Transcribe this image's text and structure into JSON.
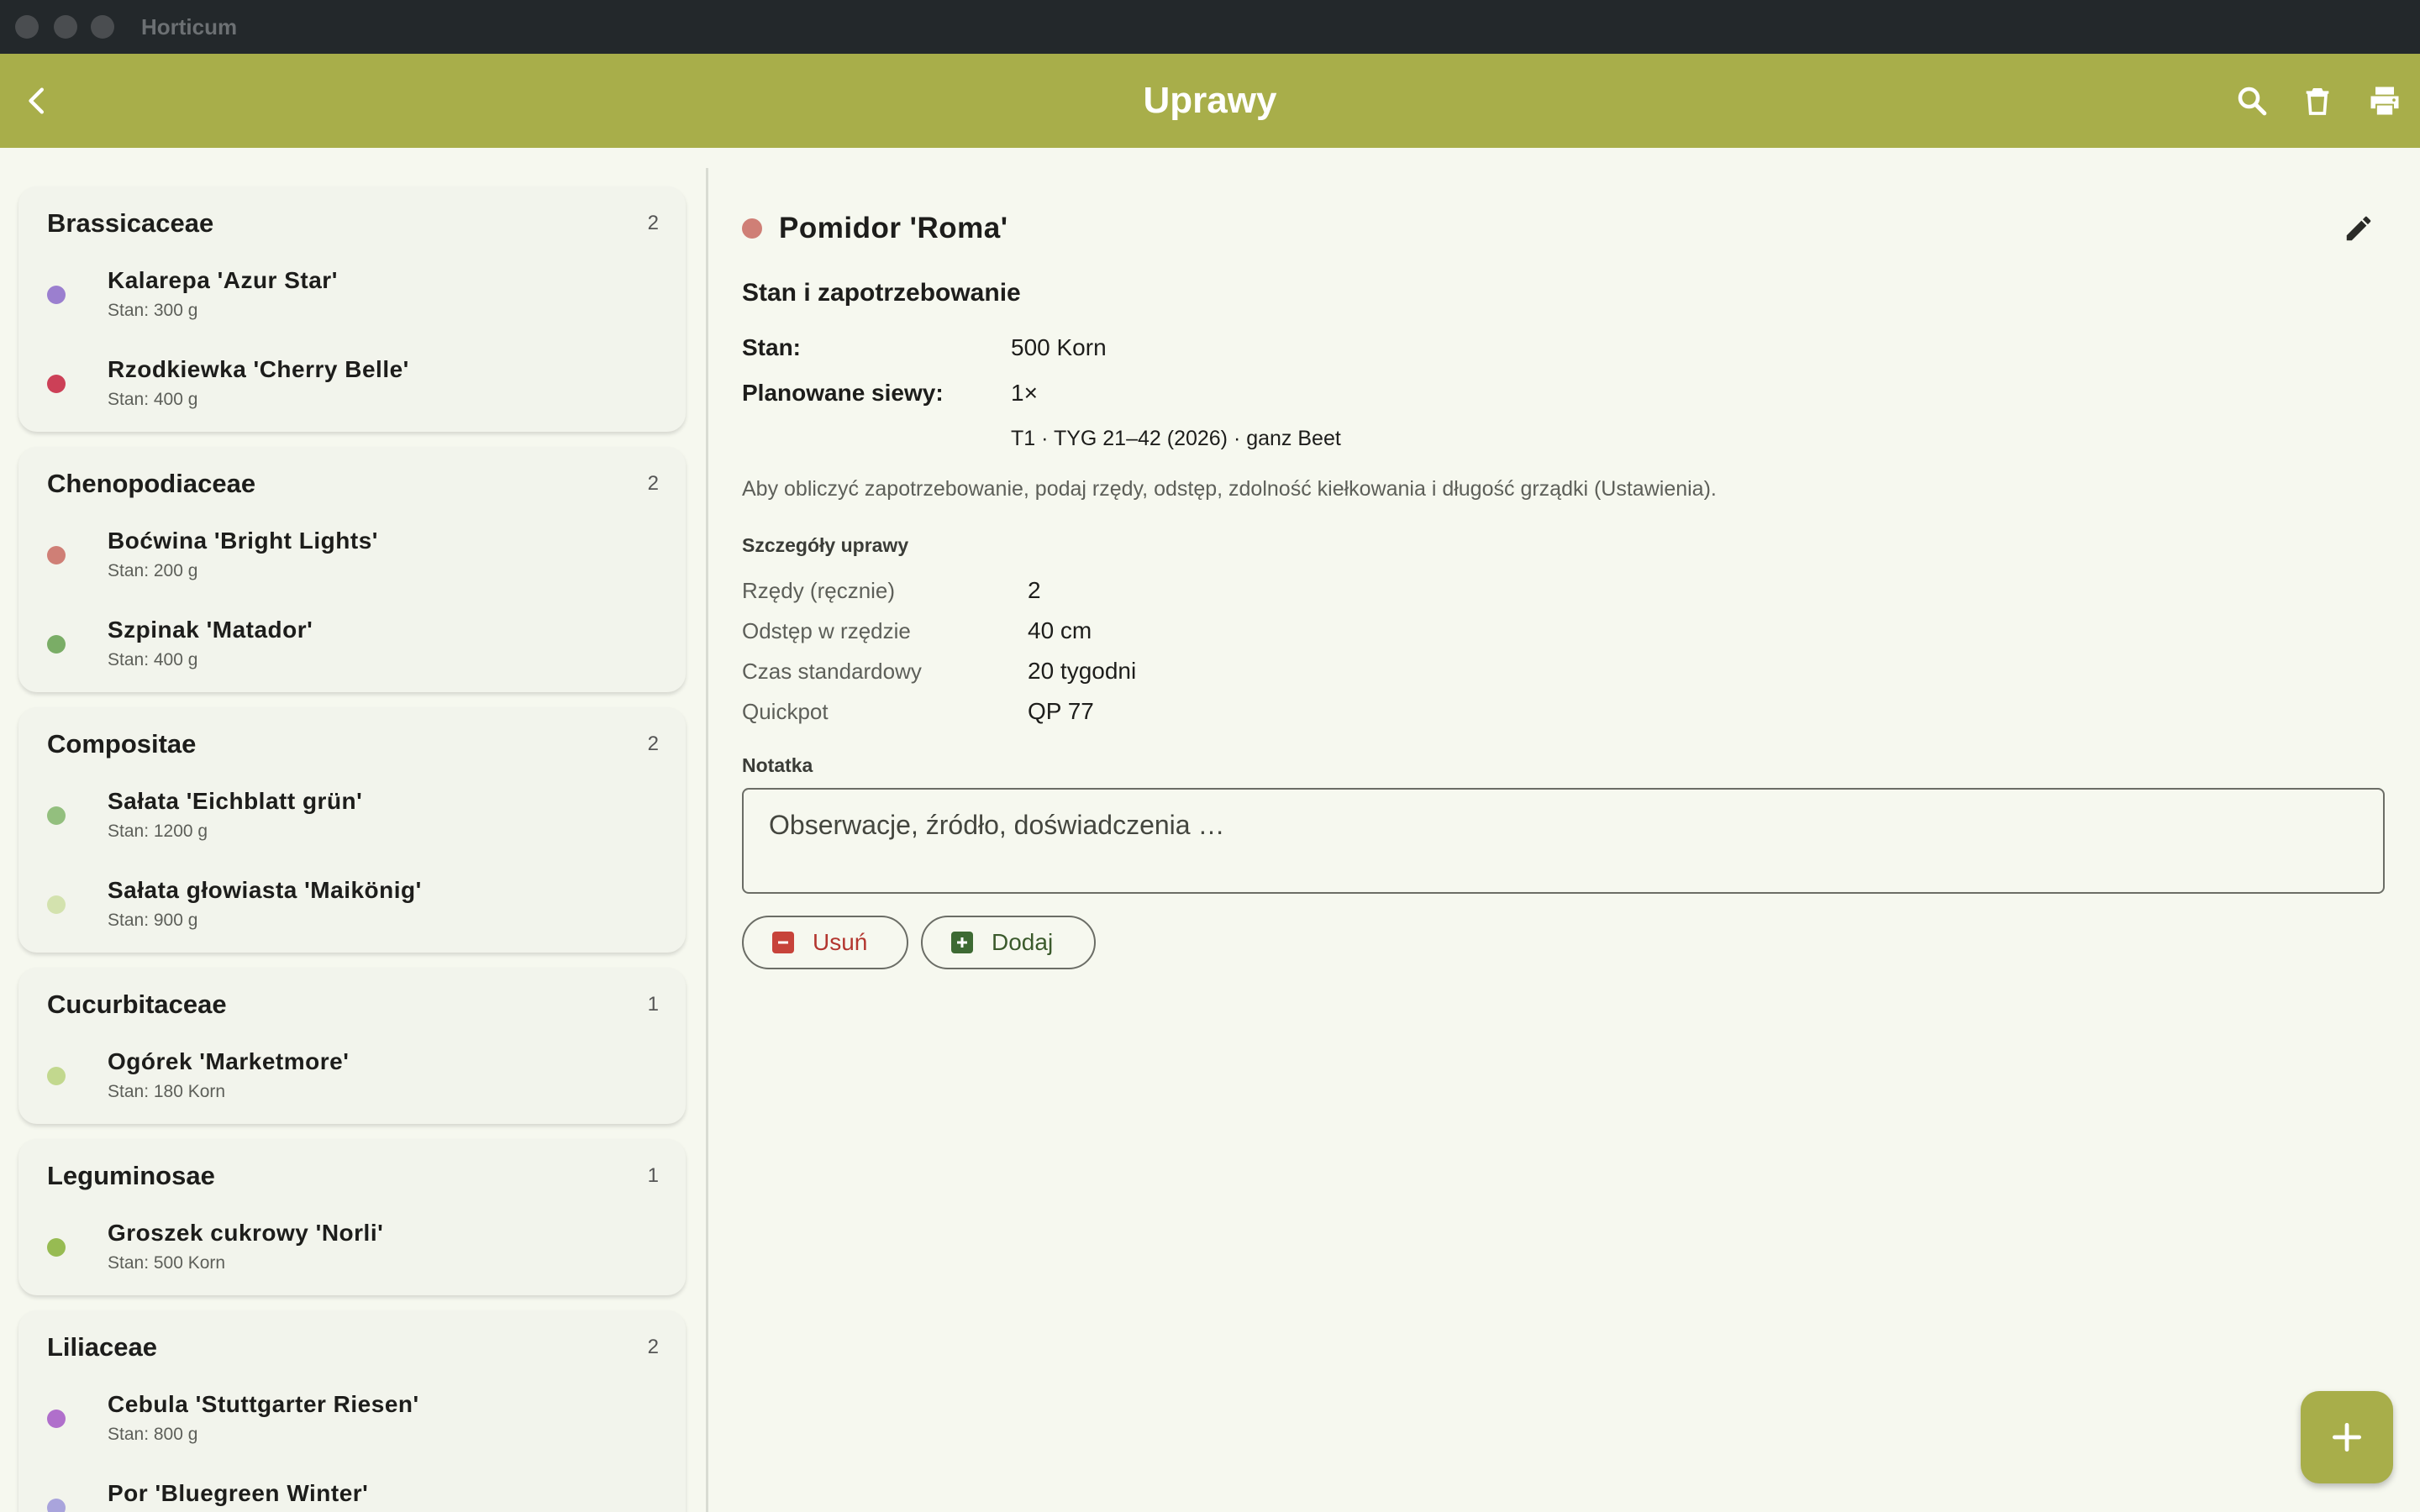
{
  "window": {
    "title": "Horticum"
  },
  "appbar": {
    "title": "Uprawy"
  },
  "groups": [
    {
      "name": "Brassicaceae",
      "count": "2",
      "items": [
        {
          "name": "Kalarepa 'Azur Star'",
          "stock": "Stan: 300 g",
          "color": "#9b7fcf"
        },
        {
          "name": "Rzodkiewka 'Cherry Belle'",
          "stock": "Stan: 400 g",
          "color": "#cc4057"
        }
      ]
    },
    {
      "name": "Chenopodiaceae",
      "count": "2",
      "items": [
        {
          "name": "Boćwina 'Bright Lights'",
          "stock": "Stan: 200 g",
          "color": "#cf7f76"
        },
        {
          "name": "Szpinak 'Matador'",
          "stock": "Stan: 400 g",
          "color": "#7aad66"
        }
      ]
    },
    {
      "name": "Compositae",
      "count": "2",
      "items": [
        {
          "name": "Sałata 'Eichblatt grün'",
          "stock": "Stan: 1200 g",
          "color": "#93bf7e"
        },
        {
          "name": "Sałata głowiasta 'Maikönig'",
          "stock": "Stan: 900 g",
          "color": "#d3e2ae"
        }
      ]
    },
    {
      "name": "Cucurbitaceae",
      "count": "1",
      "items": [
        {
          "name": "Ogórek 'Marketmore'",
          "stock": "Stan: 180 Korn",
          "color": "#c2d88e"
        }
      ]
    },
    {
      "name": "Leguminosae",
      "count": "1",
      "items": [
        {
          "name": "Groszek cukrowy 'Norli'",
          "stock": "Stan: 500 Korn",
          "color": "#97bb52"
        }
      ]
    },
    {
      "name": "Liliaceae",
      "count": "2",
      "items": [
        {
          "name": "Cebula 'Stuttgarter Riesen'",
          "stock": "Stan: 800 g",
          "color": "#b06fcb"
        },
        {
          "name": "Por 'Bluegreen Winter'",
          "stock": "",
          "color": "#a9a4dc"
        }
      ]
    }
  ],
  "detail": {
    "title": "Pomidor 'Roma'",
    "color": "#cf7f76",
    "section_title": "Stan i zapotrzebowanie",
    "stock_label": "Stan:",
    "stock_value": "500 Korn",
    "sowings_label": "Planowane siewy:",
    "sowings_value": "1×",
    "sowing_detail": "T1 · TYG 21–42 (2026) · ganz Beet",
    "hint": "Aby obliczyć zapotrzebowanie, podaj rzędy, odstęp, zdolność kiełkowania i długość grządki (Ustawienia).",
    "specs_title": "Szczegóły uprawy",
    "specs": [
      {
        "label": "Rzędy (ręcznie)",
        "value": "2"
      },
      {
        "label": "Odstęp w rzędzie",
        "value": "40 cm"
      },
      {
        "label": "Czas standardowy",
        "value": "20 tygodni"
      },
      {
        "label": "Quickpot",
        "value": "QP 77"
      }
    ],
    "note_label": "Notatka",
    "note_placeholder": "Obserwacje, źródło, doświadczenia …",
    "note_value": "",
    "remove_label": "Usuń",
    "add_label": "Dodaj"
  },
  "icons": {
    "back": "chevron-left-icon",
    "search": "search-icon",
    "delete": "trash-icon",
    "print": "printer-icon",
    "edit": "pencil-icon",
    "fab": "plus-icon"
  }
}
